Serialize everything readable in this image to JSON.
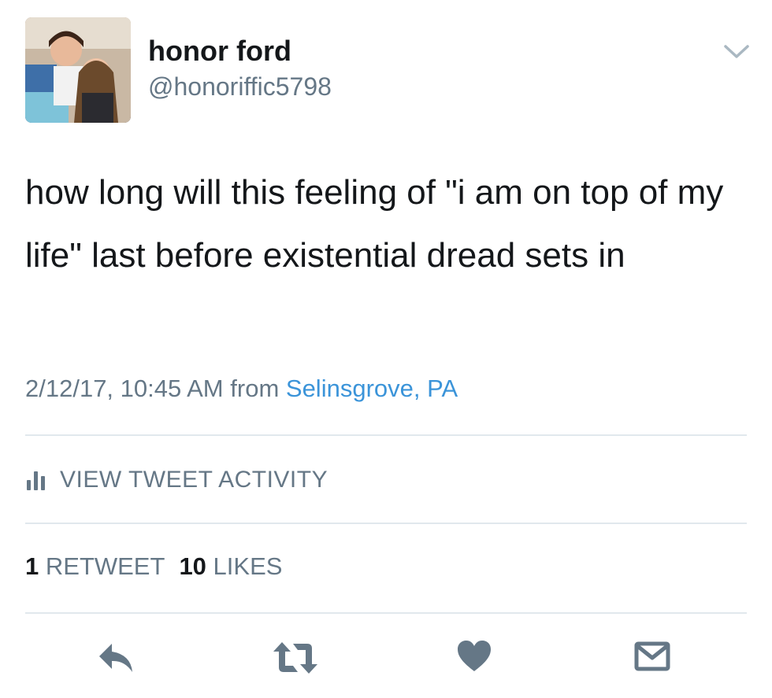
{
  "user": {
    "name": "honor ford",
    "handle": "@honoriffic5798"
  },
  "tweet": {
    "text": "how long will this feeling of \"i am on top of my life\" last before existential dread sets in",
    "timestamp": "2/12/17, 10:45 AM",
    "from_label": "from",
    "location": "Selinsgrove, PA"
  },
  "activity": {
    "label": "VIEW TWEET ACTIVITY",
    "icon": "bar-chart-icon"
  },
  "stats": {
    "retweets_count": "1",
    "retweets_label": "RETWEET",
    "likes_count": "10",
    "likes_label": "LIKES"
  },
  "actions": {
    "icons": [
      "reply-icon",
      "retweet-icon",
      "heart-icon",
      "envelope-icon"
    ]
  },
  "colors": {
    "text": "#14171a",
    "secondary": "#657786",
    "link": "#3b94d9",
    "divider": "#e1e8ed"
  }
}
